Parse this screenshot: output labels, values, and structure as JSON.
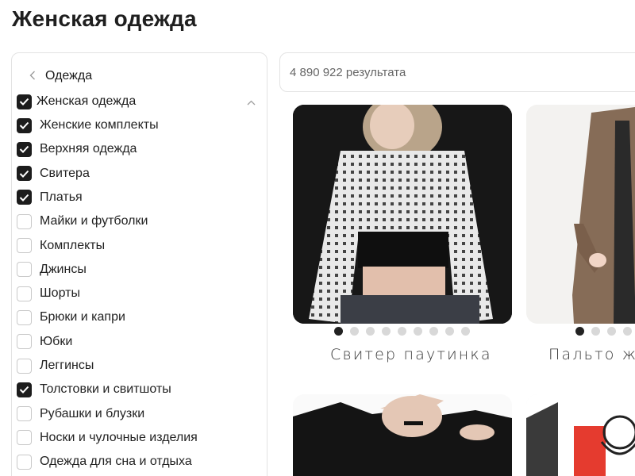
{
  "page": {
    "title": "Женская одежда"
  },
  "sidebar": {
    "back_label": "Одежда",
    "category": {
      "label": "Женская одежда",
      "checked": true
    },
    "options": [
      {
        "label": "Женские комплекты",
        "checked": true
      },
      {
        "label": "Верхняя одежда",
        "checked": true
      },
      {
        "label": "Свитера",
        "checked": true
      },
      {
        "label": "Платья",
        "checked": true
      },
      {
        "label": "Майки и футболки",
        "checked": false
      },
      {
        "label": "Комплекты",
        "checked": false
      },
      {
        "label": "Джинсы",
        "checked": false
      },
      {
        "label": "Шорты",
        "checked": false
      },
      {
        "label": "Брюки и капри",
        "checked": false
      },
      {
        "label": "Юбки",
        "checked": false
      },
      {
        "label": "Леггинсы",
        "checked": false
      },
      {
        "label": "Толстовки и свитшоты",
        "checked": true
      },
      {
        "label": "Рубашки и блузки",
        "checked": false
      },
      {
        "label": "Носки и чулочные изделия",
        "checked": false
      },
      {
        "label": "Одежда для сна и отдыха",
        "checked": false
      }
    ]
  },
  "results": {
    "count_text": "4 890 922 результата"
  },
  "products": [
    {
      "title": "Свитер паутинка",
      "image_dots": 9,
      "active_dot": 1
    },
    {
      "title": "Пальто же",
      "image_dots": 4,
      "active_dot": 1
    },
    {
      "title": "",
      "image_dots": 0,
      "active_dot": 0
    },
    {
      "title": "",
      "image_dots": 0,
      "active_dot": 0
    }
  ],
  "colors": {
    "accent": "#1c1c1c",
    "border": "#e3e3e3",
    "muted": "#666666"
  },
  "icons": {
    "back": "chevron-left-icon",
    "collapse": "chevron-up-icon",
    "check": "check-icon"
  }
}
